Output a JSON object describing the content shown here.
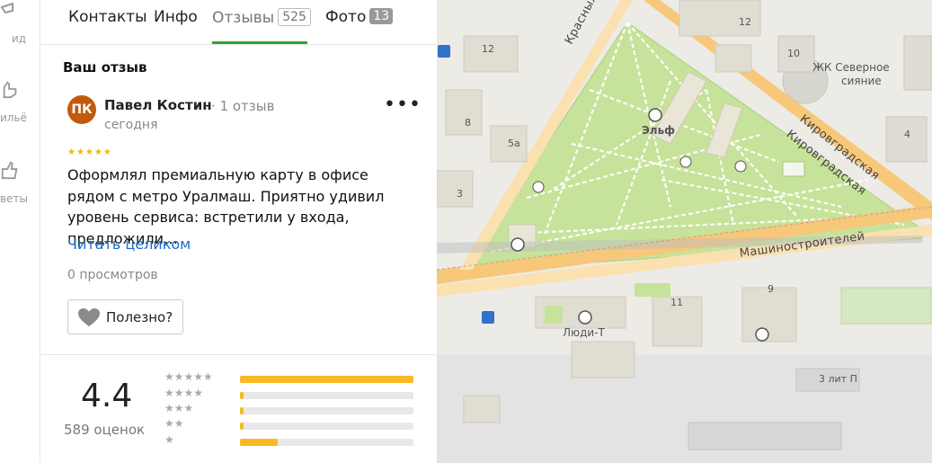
{
  "rail": {
    "items": [
      {
        "label": "ид",
        "icon": "panorama-icon"
      },
      {
        "label": "ильё",
        "icon": "hand-icon"
      },
      {
        "label": "веты",
        "icon": "thumbs-up-icon"
      }
    ]
  },
  "tabs": [
    {
      "label": "Контакты"
    },
    {
      "label": "Инфо"
    },
    {
      "label": "Отзывы",
      "count": "525",
      "active": true
    },
    {
      "label": "Фото",
      "count": "13"
    }
  ],
  "review_section": {
    "title": "Ваш отзыв",
    "author": "Павел Костин",
    "author_initials": "ПК",
    "author_meta": "· 1 отзыв",
    "date": "сегодня",
    "rating": 5,
    "stars": "★★★★★",
    "text": "Оформлял премиальную карту в офисе рядом с метро Уралмаш. Приятно удивил уровень сервиса: встретили у входа, предложили…",
    "read_more": "Читать целиком",
    "views": "0 просмотров",
    "useful_label": "Полезно?",
    "more_label": "•••"
  },
  "summary": {
    "rating": "4.4",
    "count": "589 оценок",
    "distribution": [
      {
        "stars": "★★★★★",
        "fraction": 1.0
      },
      {
        "stars": "★★★★",
        "fraction": 0.02
      },
      {
        "stars": "★★★",
        "fraction": 0.02
      },
      {
        "stars": "★★",
        "fraction": 0.02
      },
      {
        "stars": "★",
        "fraction": 0.22
      }
    ]
  },
  "map": {
    "streets": {
      "krasnykh_bortsov": "Красных Борцов",
      "kirovgradskaya_1": "Кировградская",
      "kirovgradskaya_2": "Кировградская",
      "mashinostroiteley": "Машиностроителей"
    },
    "places": {
      "elf": "Эльф",
      "lyudi_t": "Люди-Т",
      "zhk": "ЖК Северное",
      "zhk2": "сияние",
      "lit": "3 лит П"
    },
    "numbers": [
      "12",
      "12",
      "8",
      "5а",
      "3",
      "10",
      "4",
      "11",
      "9"
    ]
  },
  "colors": {
    "accent_green": "#2fa532",
    "star": "#f6b600",
    "bar": "#f9b824",
    "link": "#1a69c9",
    "avatar": "#c25a0e",
    "park": "#c7e29a",
    "road": "#f7c77a"
  }
}
